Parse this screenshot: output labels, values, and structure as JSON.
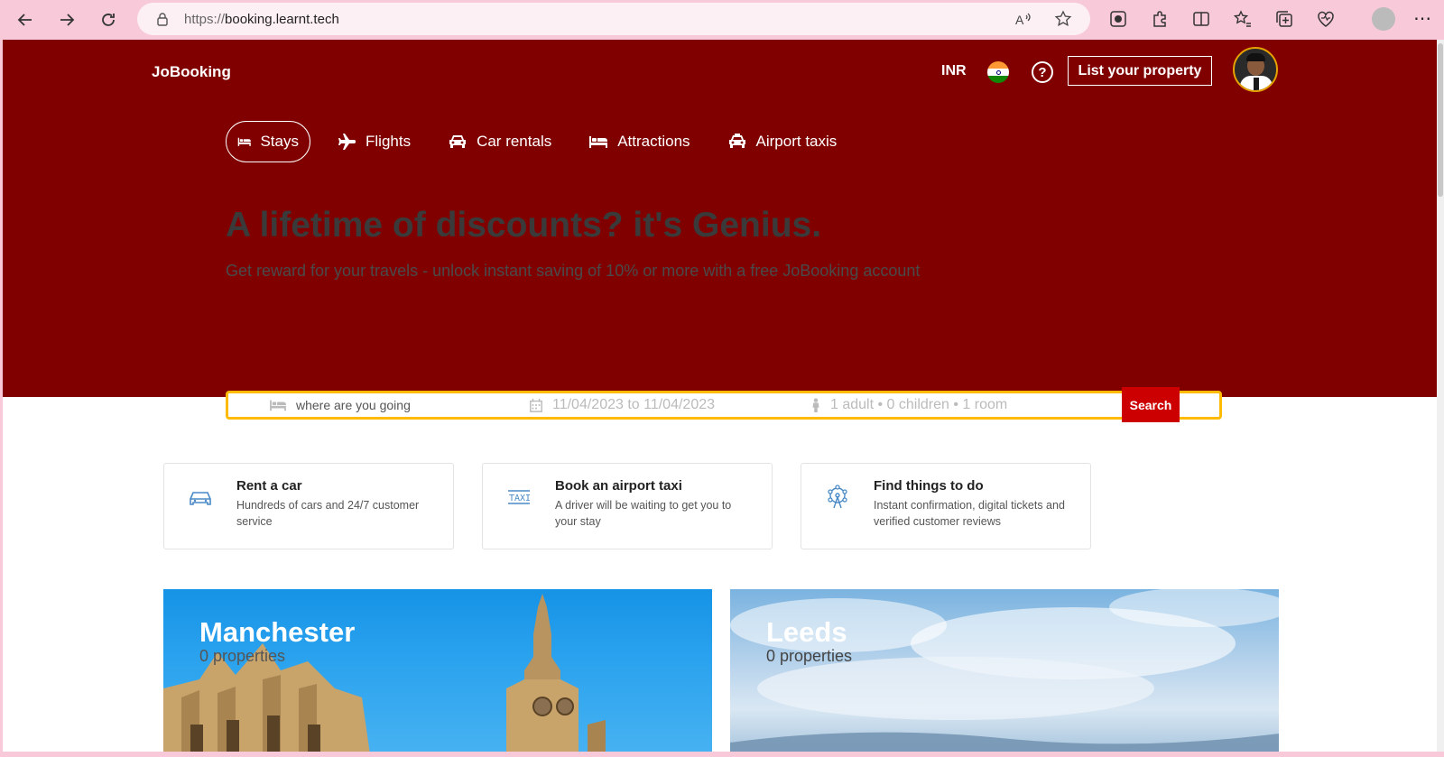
{
  "browser": {
    "url_prefix": "https://",
    "url_host": "booking.learnt.tech"
  },
  "header": {
    "brand": "JoBooking",
    "currency": "INR",
    "list_property": "List your property"
  },
  "tabs": [
    {
      "label": "Stays",
      "icon": "bed-icon",
      "active": true
    },
    {
      "label": "Flights",
      "icon": "plane-icon",
      "active": false
    },
    {
      "label": "Car rentals",
      "icon": "car-icon",
      "active": false
    },
    {
      "label": "Attractions",
      "icon": "bed-icon",
      "active": false
    },
    {
      "label": "Airport taxis",
      "icon": "taxi-icon",
      "active": false
    }
  ],
  "hero": {
    "headline": "A lifetime of discounts? it's Genius.",
    "subline": "Get reward for your travels - unlock instant saving of 10% or more with a free JoBooking account"
  },
  "search": {
    "destination_placeholder": "where are you going",
    "dates": "11/04/2023 to 11/04/2023",
    "guests": "1 adult • 0 children • 1 room",
    "button": "Search"
  },
  "cards": [
    {
      "title": "Rent a car",
      "desc": "Hundreds of cars and 24/7 customer service",
      "icon": "car-outline-icon"
    },
    {
      "title": "Book an airport taxi",
      "desc": "A driver will be waiting to get you to your stay",
      "icon": "taxi-sign-icon"
    },
    {
      "title": "Find things to do",
      "desc": "Instant confirmation, digital tickets and verified customer reviews",
      "icon": "ferris-wheel-icon"
    }
  ],
  "cities": [
    {
      "name": "Manchester",
      "properties": "0 properties"
    },
    {
      "name": "Leeds",
      "properties": "0 properties"
    }
  ],
  "colors": {
    "hero_bg": "#800000",
    "search_border": "#febb02",
    "search_button": "#cc0000",
    "card_icon": "#4a8ac7"
  }
}
